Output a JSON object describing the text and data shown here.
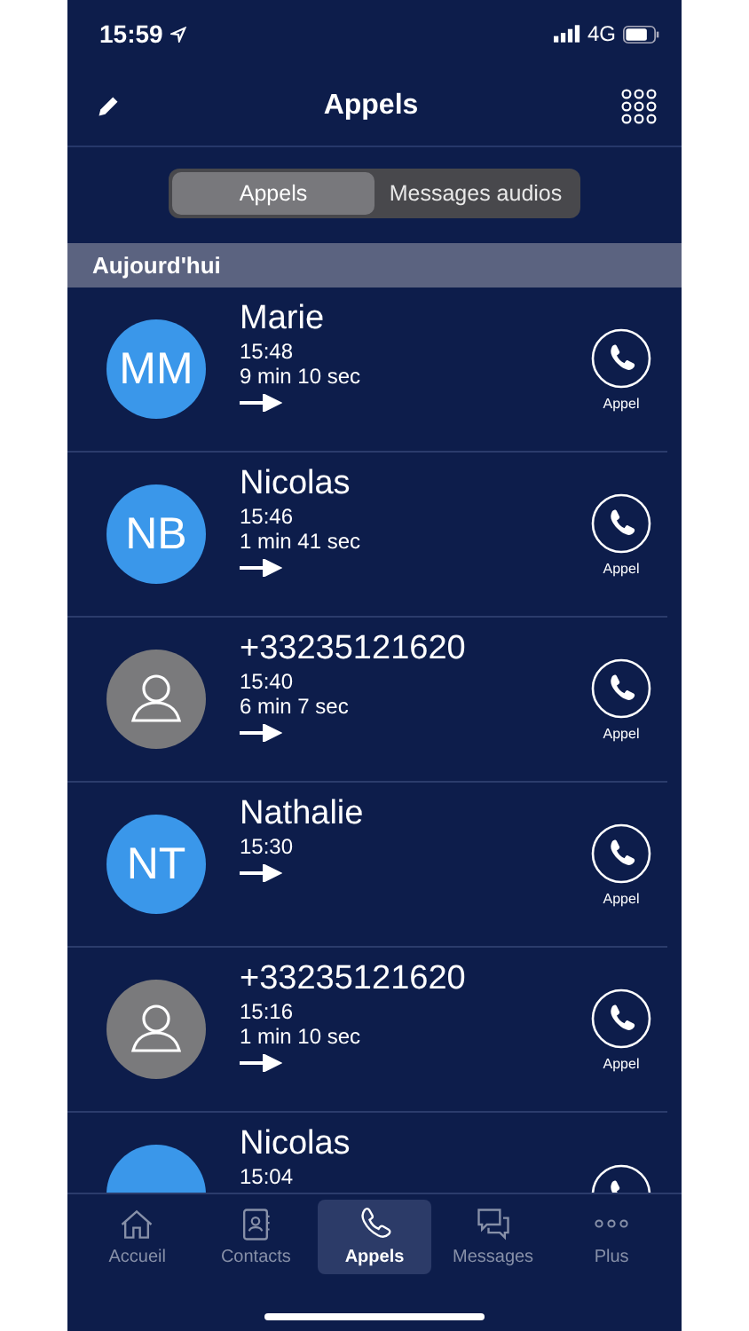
{
  "status_bar": {
    "time": "15:59",
    "network": "4G"
  },
  "header": {
    "title": "Appels"
  },
  "segments": [
    {
      "label": "Appels",
      "selected": true
    },
    {
      "label": "Messages audios",
      "selected": false
    }
  ],
  "section": {
    "title": "Aujourd'hui"
  },
  "calls": [
    {
      "kind": "contact",
      "name": "Marie",
      "initials": "MM",
      "time": "15:48",
      "duration": "9 min 10 sec",
      "outgoing": true,
      "call_label": "Appel"
    },
    {
      "kind": "contact",
      "name": "Nicolas",
      "initials": "NB",
      "time": "15:46",
      "duration": "1 min 41 sec",
      "outgoing": true,
      "call_label": "Appel"
    },
    {
      "kind": "unknown",
      "name": "+33235121620",
      "time": "15:40",
      "duration": "6 min 7 sec",
      "outgoing": true,
      "call_label": "Appel"
    },
    {
      "kind": "contact",
      "name": "Nathalie",
      "initials": "NT",
      "time": "15:30",
      "outgoing": true,
      "call_label": "Appel"
    },
    {
      "kind": "unknown",
      "name": "+33235121620",
      "time": "15:16",
      "duration": "1 min 10 sec",
      "outgoing": true,
      "call_label": "Appel"
    },
    {
      "kind": "contact",
      "name": "Nicolas",
      "time": "15:04"
    }
  ],
  "tab_bar": [
    {
      "label": "Accueil",
      "selected": false
    },
    {
      "label": "Contacts",
      "selected": false
    },
    {
      "label": "Appels",
      "selected": true
    },
    {
      "label": "Messages",
      "selected": false
    },
    {
      "label": "Plus",
      "selected": false
    }
  ]
}
